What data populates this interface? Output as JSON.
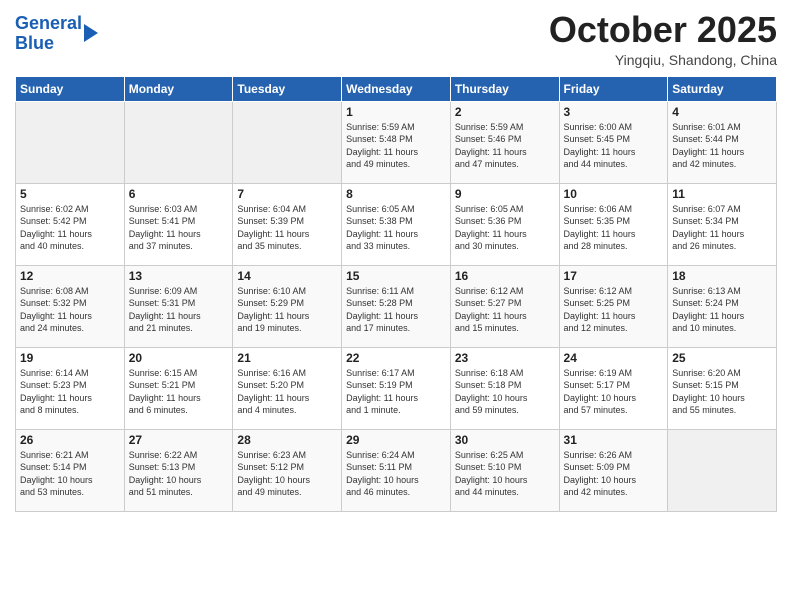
{
  "header": {
    "logo_line1": "General",
    "logo_line2": "Blue",
    "month": "October 2025",
    "location": "Yingqiu, Shandong, China"
  },
  "weekdays": [
    "Sunday",
    "Monday",
    "Tuesday",
    "Wednesday",
    "Thursday",
    "Friday",
    "Saturday"
  ],
  "weeks": [
    [
      {
        "day": "",
        "info": ""
      },
      {
        "day": "",
        "info": ""
      },
      {
        "day": "",
        "info": ""
      },
      {
        "day": "1",
        "info": "Sunrise: 5:59 AM\nSunset: 5:48 PM\nDaylight: 11 hours\nand 49 minutes."
      },
      {
        "day": "2",
        "info": "Sunrise: 5:59 AM\nSunset: 5:46 PM\nDaylight: 11 hours\nand 47 minutes."
      },
      {
        "day": "3",
        "info": "Sunrise: 6:00 AM\nSunset: 5:45 PM\nDaylight: 11 hours\nand 44 minutes."
      },
      {
        "day": "4",
        "info": "Sunrise: 6:01 AM\nSunset: 5:44 PM\nDaylight: 11 hours\nand 42 minutes."
      }
    ],
    [
      {
        "day": "5",
        "info": "Sunrise: 6:02 AM\nSunset: 5:42 PM\nDaylight: 11 hours\nand 40 minutes."
      },
      {
        "day": "6",
        "info": "Sunrise: 6:03 AM\nSunset: 5:41 PM\nDaylight: 11 hours\nand 37 minutes."
      },
      {
        "day": "7",
        "info": "Sunrise: 6:04 AM\nSunset: 5:39 PM\nDaylight: 11 hours\nand 35 minutes."
      },
      {
        "day": "8",
        "info": "Sunrise: 6:05 AM\nSunset: 5:38 PM\nDaylight: 11 hours\nand 33 minutes."
      },
      {
        "day": "9",
        "info": "Sunrise: 6:05 AM\nSunset: 5:36 PM\nDaylight: 11 hours\nand 30 minutes."
      },
      {
        "day": "10",
        "info": "Sunrise: 6:06 AM\nSunset: 5:35 PM\nDaylight: 11 hours\nand 28 minutes."
      },
      {
        "day": "11",
        "info": "Sunrise: 6:07 AM\nSunset: 5:34 PM\nDaylight: 11 hours\nand 26 minutes."
      }
    ],
    [
      {
        "day": "12",
        "info": "Sunrise: 6:08 AM\nSunset: 5:32 PM\nDaylight: 11 hours\nand 24 minutes."
      },
      {
        "day": "13",
        "info": "Sunrise: 6:09 AM\nSunset: 5:31 PM\nDaylight: 11 hours\nand 21 minutes."
      },
      {
        "day": "14",
        "info": "Sunrise: 6:10 AM\nSunset: 5:29 PM\nDaylight: 11 hours\nand 19 minutes."
      },
      {
        "day": "15",
        "info": "Sunrise: 6:11 AM\nSunset: 5:28 PM\nDaylight: 11 hours\nand 17 minutes."
      },
      {
        "day": "16",
        "info": "Sunrise: 6:12 AM\nSunset: 5:27 PM\nDaylight: 11 hours\nand 15 minutes."
      },
      {
        "day": "17",
        "info": "Sunrise: 6:12 AM\nSunset: 5:25 PM\nDaylight: 11 hours\nand 12 minutes."
      },
      {
        "day": "18",
        "info": "Sunrise: 6:13 AM\nSunset: 5:24 PM\nDaylight: 11 hours\nand 10 minutes."
      }
    ],
    [
      {
        "day": "19",
        "info": "Sunrise: 6:14 AM\nSunset: 5:23 PM\nDaylight: 11 hours\nand 8 minutes."
      },
      {
        "day": "20",
        "info": "Sunrise: 6:15 AM\nSunset: 5:21 PM\nDaylight: 11 hours\nand 6 minutes."
      },
      {
        "day": "21",
        "info": "Sunrise: 6:16 AM\nSunset: 5:20 PM\nDaylight: 11 hours\nand 4 minutes."
      },
      {
        "day": "22",
        "info": "Sunrise: 6:17 AM\nSunset: 5:19 PM\nDaylight: 11 hours\nand 1 minute."
      },
      {
        "day": "23",
        "info": "Sunrise: 6:18 AM\nSunset: 5:18 PM\nDaylight: 10 hours\nand 59 minutes."
      },
      {
        "day": "24",
        "info": "Sunrise: 6:19 AM\nSunset: 5:17 PM\nDaylight: 10 hours\nand 57 minutes."
      },
      {
        "day": "25",
        "info": "Sunrise: 6:20 AM\nSunset: 5:15 PM\nDaylight: 10 hours\nand 55 minutes."
      }
    ],
    [
      {
        "day": "26",
        "info": "Sunrise: 6:21 AM\nSunset: 5:14 PM\nDaylight: 10 hours\nand 53 minutes."
      },
      {
        "day": "27",
        "info": "Sunrise: 6:22 AM\nSunset: 5:13 PM\nDaylight: 10 hours\nand 51 minutes."
      },
      {
        "day": "28",
        "info": "Sunrise: 6:23 AM\nSunset: 5:12 PM\nDaylight: 10 hours\nand 49 minutes."
      },
      {
        "day": "29",
        "info": "Sunrise: 6:24 AM\nSunset: 5:11 PM\nDaylight: 10 hours\nand 46 minutes."
      },
      {
        "day": "30",
        "info": "Sunrise: 6:25 AM\nSunset: 5:10 PM\nDaylight: 10 hours\nand 44 minutes."
      },
      {
        "day": "31",
        "info": "Sunrise: 6:26 AM\nSunset: 5:09 PM\nDaylight: 10 hours\nand 42 minutes."
      },
      {
        "day": "",
        "info": ""
      }
    ]
  ]
}
